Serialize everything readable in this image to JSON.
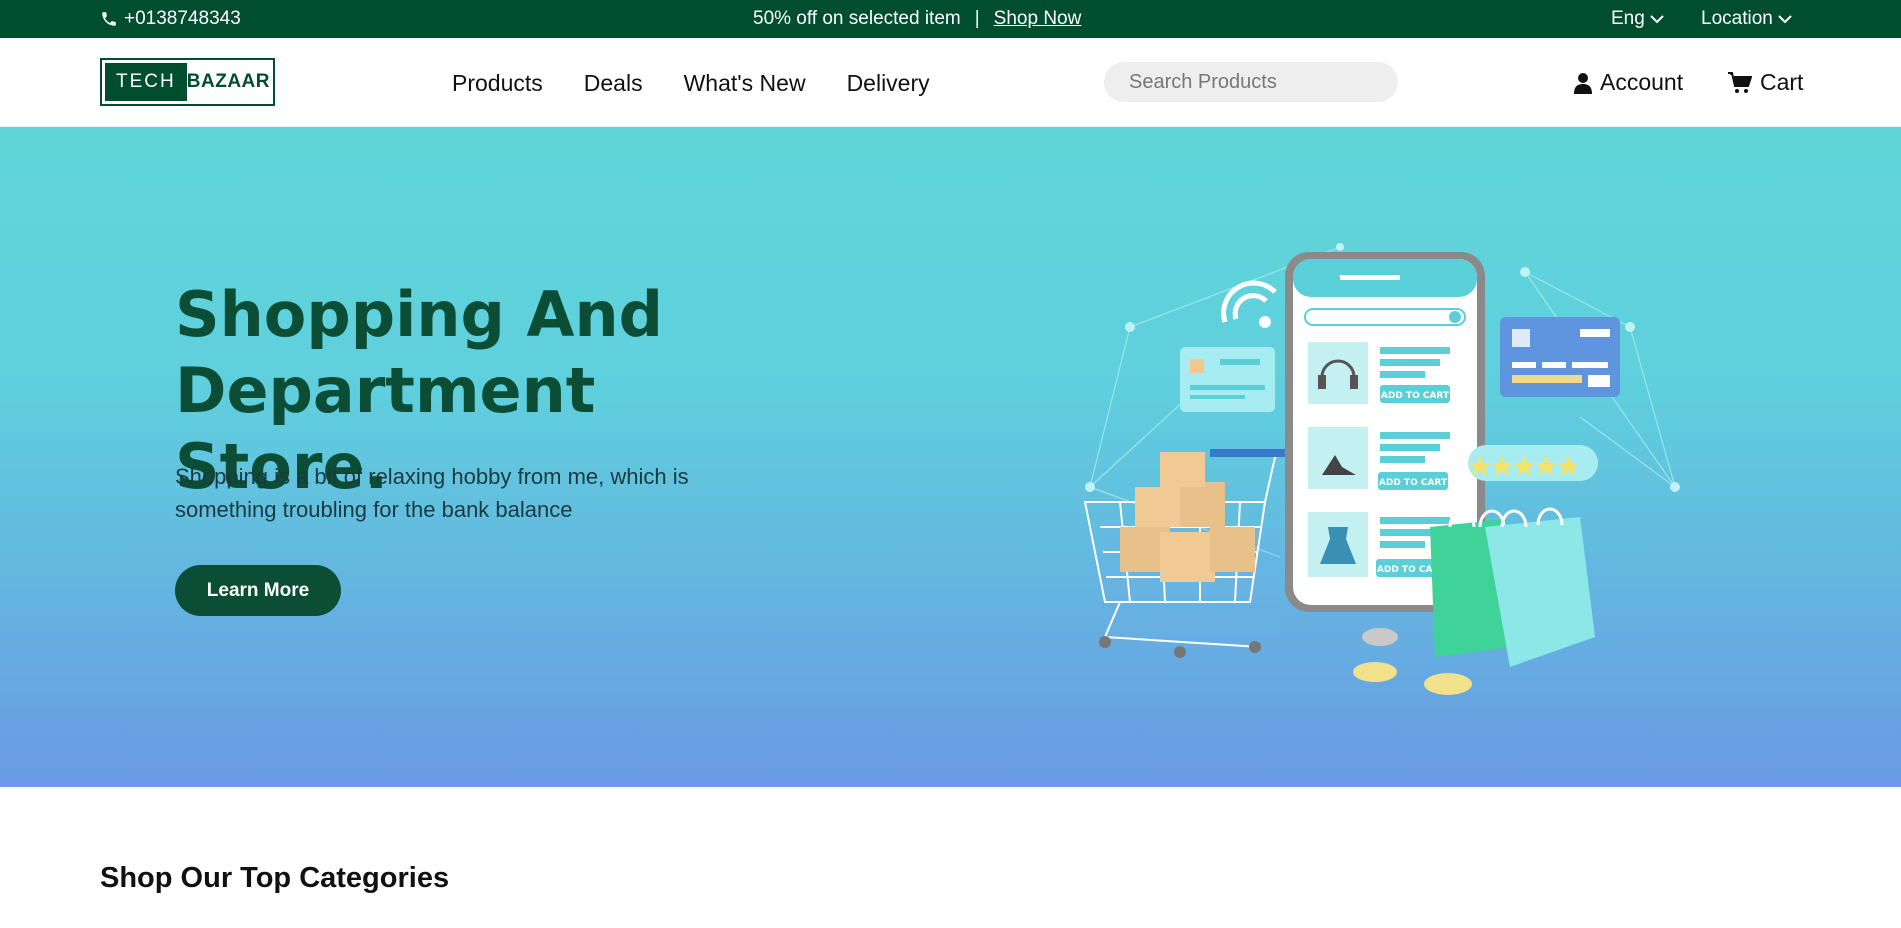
{
  "topbar": {
    "phone": "+0138748343",
    "promo_text": "50% off on selected item",
    "separator": "|",
    "promo_link": "Shop Now",
    "language": "Eng",
    "location": "Location"
  },
  "header": {
    "logo_part1": "TECH",
    "logo_part2": "BAZAAR",
    "nav": [
      "Products",
      "Deals",
      "What's New",
      "Delivery"
    ],
    "search_placeholder": "Search Products",
    "account": "Account",
    "cart": "Cart"
  },
  "hero": {
    "title_line1": "Shopping And",
    "title_line2": "Department Store.",
    "description": "Shopping is a bit of relaxing hobby from me, which is something troubling for the bank balance",
    "button": "Learn More",
    "illustration": {
      "add_to_cart": "ADD TO CART"
    }
  },
  "categories": {
    "title": "Shop Our Top Categories"
  },
  "colors": {
    "brand": "#004d30",
    "hero_top": "#60d6d8",
    "hero_bottom": "#6a9ae4"
  }
}
